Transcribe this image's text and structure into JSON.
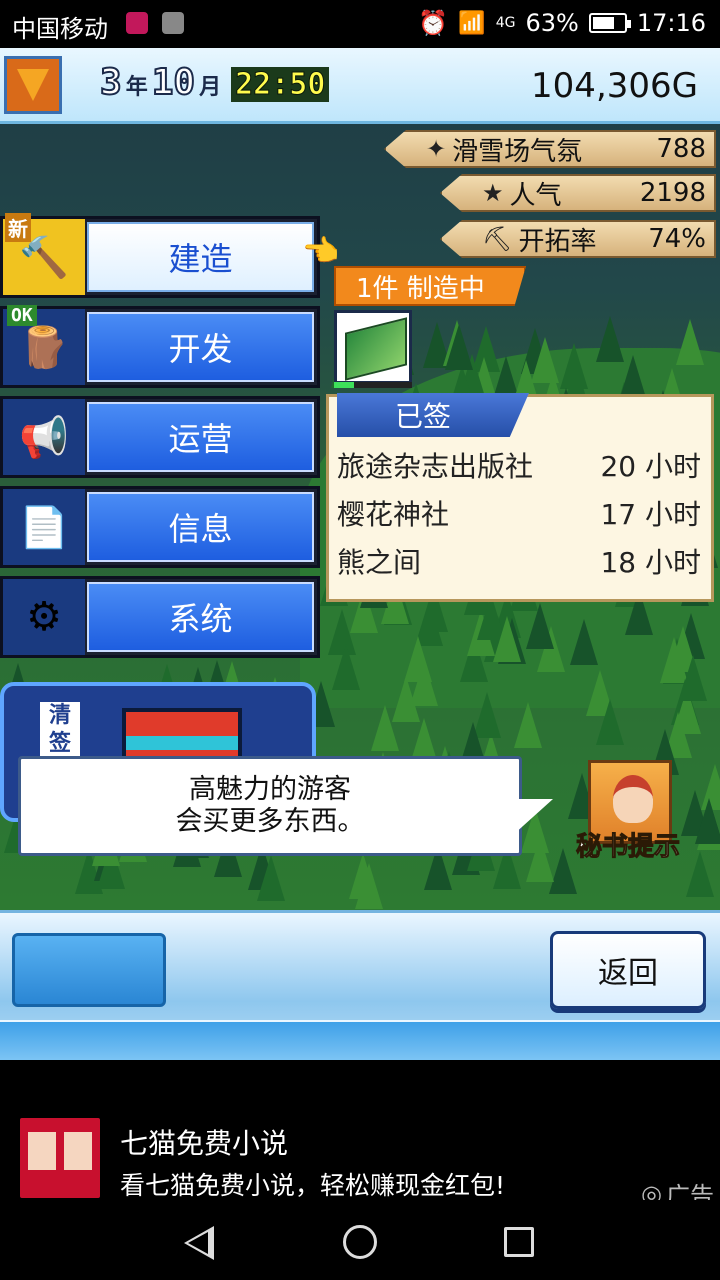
{
  "status_bar": {
    "carrier": "中国移动",
    "network": "4G",
    "battery": "63%",
    "time": "17:16",
    "icons": [
      "weibo-icon",
      "image-icon",
      "alarm-icon",
      "wifi-icon",
      "signal-icon",
      "battery-icon"
    ]
  },
  "top_bar": {
    "year": "3",
    "year_unit": "年",
    "month": "10",
    "month_unit": "月",
    "clock": "22:50",
    "money": "104,306G"
  },
  "stats": [
    {
      "label": "滑雪场气氛",
      "value": "788",
      "icon": "sparkle-icon"
    },
    {
      "label": "人气",
      "value": "2198",
      "icon": "star-icon"
    },
    {
      "label": "开拓率",
      "value": "74%",
      "icon": "pickaxe-icon"
    }
  ],
  "menu": [
    {
      "label": "建造",
      "tag": "新",
      "icon": "hammer-icon",
      "active": true
    },
    {
      "label": "开发",
      "tag": "OK",
      "icon": "log-icon",
      "active": false
    },
    {
      "label": "运营",
      "tag": "",
      "icon": "megaphone-icon",
      "active": false
    },
    {
      "label": "信息",
      "tag": "",
      "icon": "document-icon",
      "active": false
    },
    {
      "label": "系统",
      "tag": "",
      "icon": "gear-icon",
      "active": false
    }
  ],
  "build": {
    "status": "1件 制造中",
    "progress": 0.25
  },
  "contract": {
    "title": "已签",
    "rows": [
      {
        "name": "旅途杂志出版社",
        "time": "20 小时"
      },
      {
        "name": "樱花神社",
        "time": "17 小时"
      },
      {
        "name": "熊之间",
        "time": "18 小时"
      }
    ]
  },
  "left_panel": {
    "qian": "清签"
  },
  "message": {
    "line1": "高魅力的游客",
    "line2": "会买更多东西。"
  },
  "secretary": {
    "label": "秘书提示"
  },
  "bottom": {
    "back_label": "返回"
  },
  "ad": {
    "title": "七猫免费小说",
    "desc": "看七猫免费小说，轻松赚现金红包!",
    "mark": "广告"
  },
  "colors": {
    "accent_blue": "#1e5ee0",
    "stat_banner": "#d6b27c",
    "progress_green": "#3ee05a",
    "badge_orange": "#f2891c"
  }
}
